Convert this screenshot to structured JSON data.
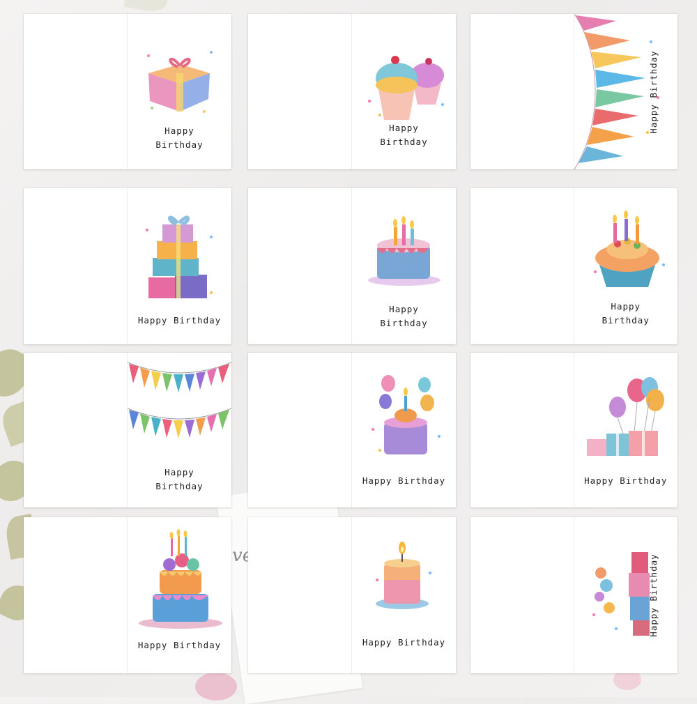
{
  "greeting": {
    "happy": "Happy",
    "birthday": "Birthday",
    "full": "Happy Birthday"
  },
  "background_script": "ve",
  "cards": [
    {
      "design": "gift-box"
    },
    {
      "design": "cupcakes"
    },
    {
      "design": "bunting-vertical"
    },
    {
      "design": "gift-stack"
    },
    {
      "design": "candle-cake"
    },
    {
      "design": "cupcake-candles"
    },
    {
      "design": "bunting-garland"
    },
    {
      "design": "balloon-cake"
    },
    {
      "design": "balloons-gifts"
    },
    {
      "design": "tiered-cake"
    },
    {
      "design": "pillar-candle"
    },
    {
      "design": "present-tower"
    }
  ],
  "colors": {
    "card": "#ffffff",
    "text": "#222222",
    "background": "#f2f1f0"
  }
}
